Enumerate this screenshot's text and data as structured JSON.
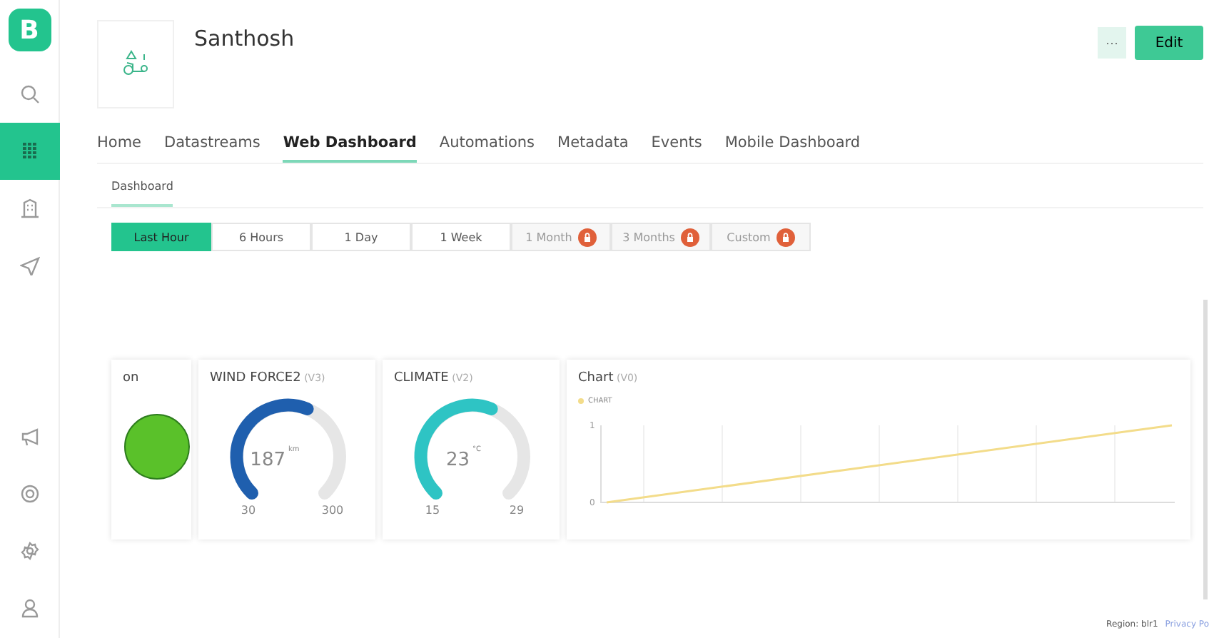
{
  "sidebar": {
    "logo": "B",
    "items": [
      {
        "selected": false
      },
      {
        "selected": true
      },
      {
        "selected": false
      },
      {
        "selected": false
      },
      {
        "selected": false
      },
      {
        "selected": false
      },
      {
        "selected": false
      },
      {
        "selected": false
      }
    ]
  },
  "device": {
    "name": "Santhosh"
  },
  "actions": {
    "more": "···",
    "edit": "Edit"
  },
  "tabs": [
    {
      "label": "Home",
      "selected": false
    },
    {
      "label": "Datastreams",
      "selected": false
    },
    {
      "label": "Web Dashboard",
      "selected": true
    },
    {
      "label": "Automations",
      "selected": false
    },
    {
      "label": "Metadata",
      "selected": false
    },
    {
      "label": "Events",
      "selected": false
    },
    {
      "label": "Mobile Dashboard",
      "selected": false
    }
  ],
  "subtabs": [
    {
      "label": "Dashboard",
      "selected": true
    }
  ],
  "time_ranges": [
    {
      "label": "Last Hour",
      "selected": true,
      "locked": false
    },
    {
      "label": "6 Hours",
      "selected": false,
      "locked": false
    },
    {
      "label": "1 Day",
      "selected": false,
      "locked": false
    },
    {
      "label": "1 Week",
      "selected": false,
      "locked": false
    },
    {
      "label": "1 Month",
      "selected": false,
      "locked": true
    },
    {
      "label": "3 Months",
      "selected": false,
      "locked": true
    },
    {
      "label": "Custom",
      "selected": false,
      "locked": true
    }
  ],
  "widgets": [
    {
      "kind": "led",
      "title": "on",
      "on": true
    },
    {
      "kind": "gauge",
      "title": "WIND FORCE2",
      "pin": "(V3)",
      "value": "187",
      "unit": "km",
      "min": "30",
      "max": "300",
      "color": "#1f5fae"
    },
    {
      "kind": "gauge",
      "title": "CLIMATE",
      "pin": "(V2)",
      "value": "23",
      "unit": "°C",
      "min": "15",
      "max": "29",
      "color": "#2ec4c4"
    },
    {
      "kind": "chart",
      "title": "Chart",
      "pin": "(V0)",
      "chart_data": {
        "type": "line",
        "yticks": [
          0,
          1
        ],
        "ylim": [
          0,
          1
        ],
        "series": [
          {
            "name": "CHART",
            "color": "#f3dc8a",
            "values": [
              0,
              1
            ]
          }
        ]
      }
    }
  ],
  "footer": {
    "region": "Region: blr1",
    "privacy": "Privacy Po"
  }
}
